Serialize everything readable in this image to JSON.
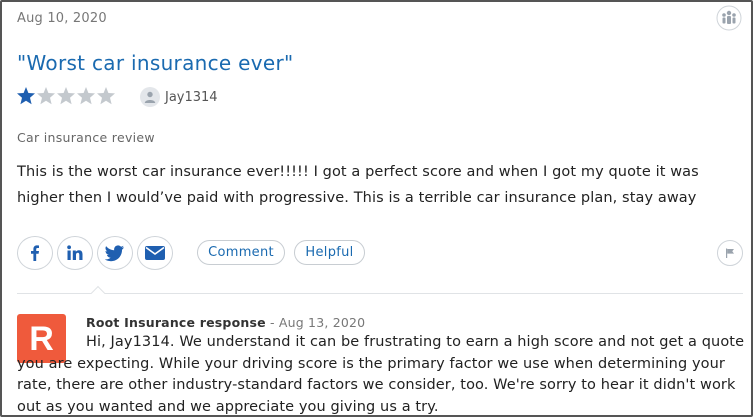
{
  "review": {
    "date": "Aug 10, 2020",
    "title": "\"Worst car insurance ever\"",
    "rating": 1,
    "rating_max": 5,
    "username": "Jay1314",
    "category": "Car insurance review",
    "body_line1": "This is the worst car insurance ever!!!!! I got a perfect score and when I got my quote it was",
    "body_line2": "higher then I would’ve paid with progressive. This is a terrible car insurance plan, stay away"
  },
  "actions": {
    "comment_label": "Comment",
    "helpful_label": "Helpful"
  },
  "response": {
    "logo_letter": "R",
    "responder": "Root Insurance response",
    "separator": " - ",
    "date": "Aug 13, 2020",
    "text": "Hi, Jay1314. We understand it can be frustrating to earn a high score and not get a quote you are expecting. While your driving score is the primary factor we use when determining your rate, there are other industry-standard factors we consider, too. We're sorry to hear it didn't work out as you wanted and we appreciate you giving us a try."
  },
  "colors": {
    "title_blue": "#1a6ab0",
    "star_filled": "#1f5fb0",
    "star_empty": "#c4c9ce",
    "logo_bg": "#ef5a3c"
  },
  "icons": {
    "corner": "agents-icon",
    "share": [
      "facebook-icon",
      "linkedin-icon",
      "twitter-icon",
      "email-icon"
    ],
    "flag": "flag-icon",
    "user": "user-icon"
  }
}
